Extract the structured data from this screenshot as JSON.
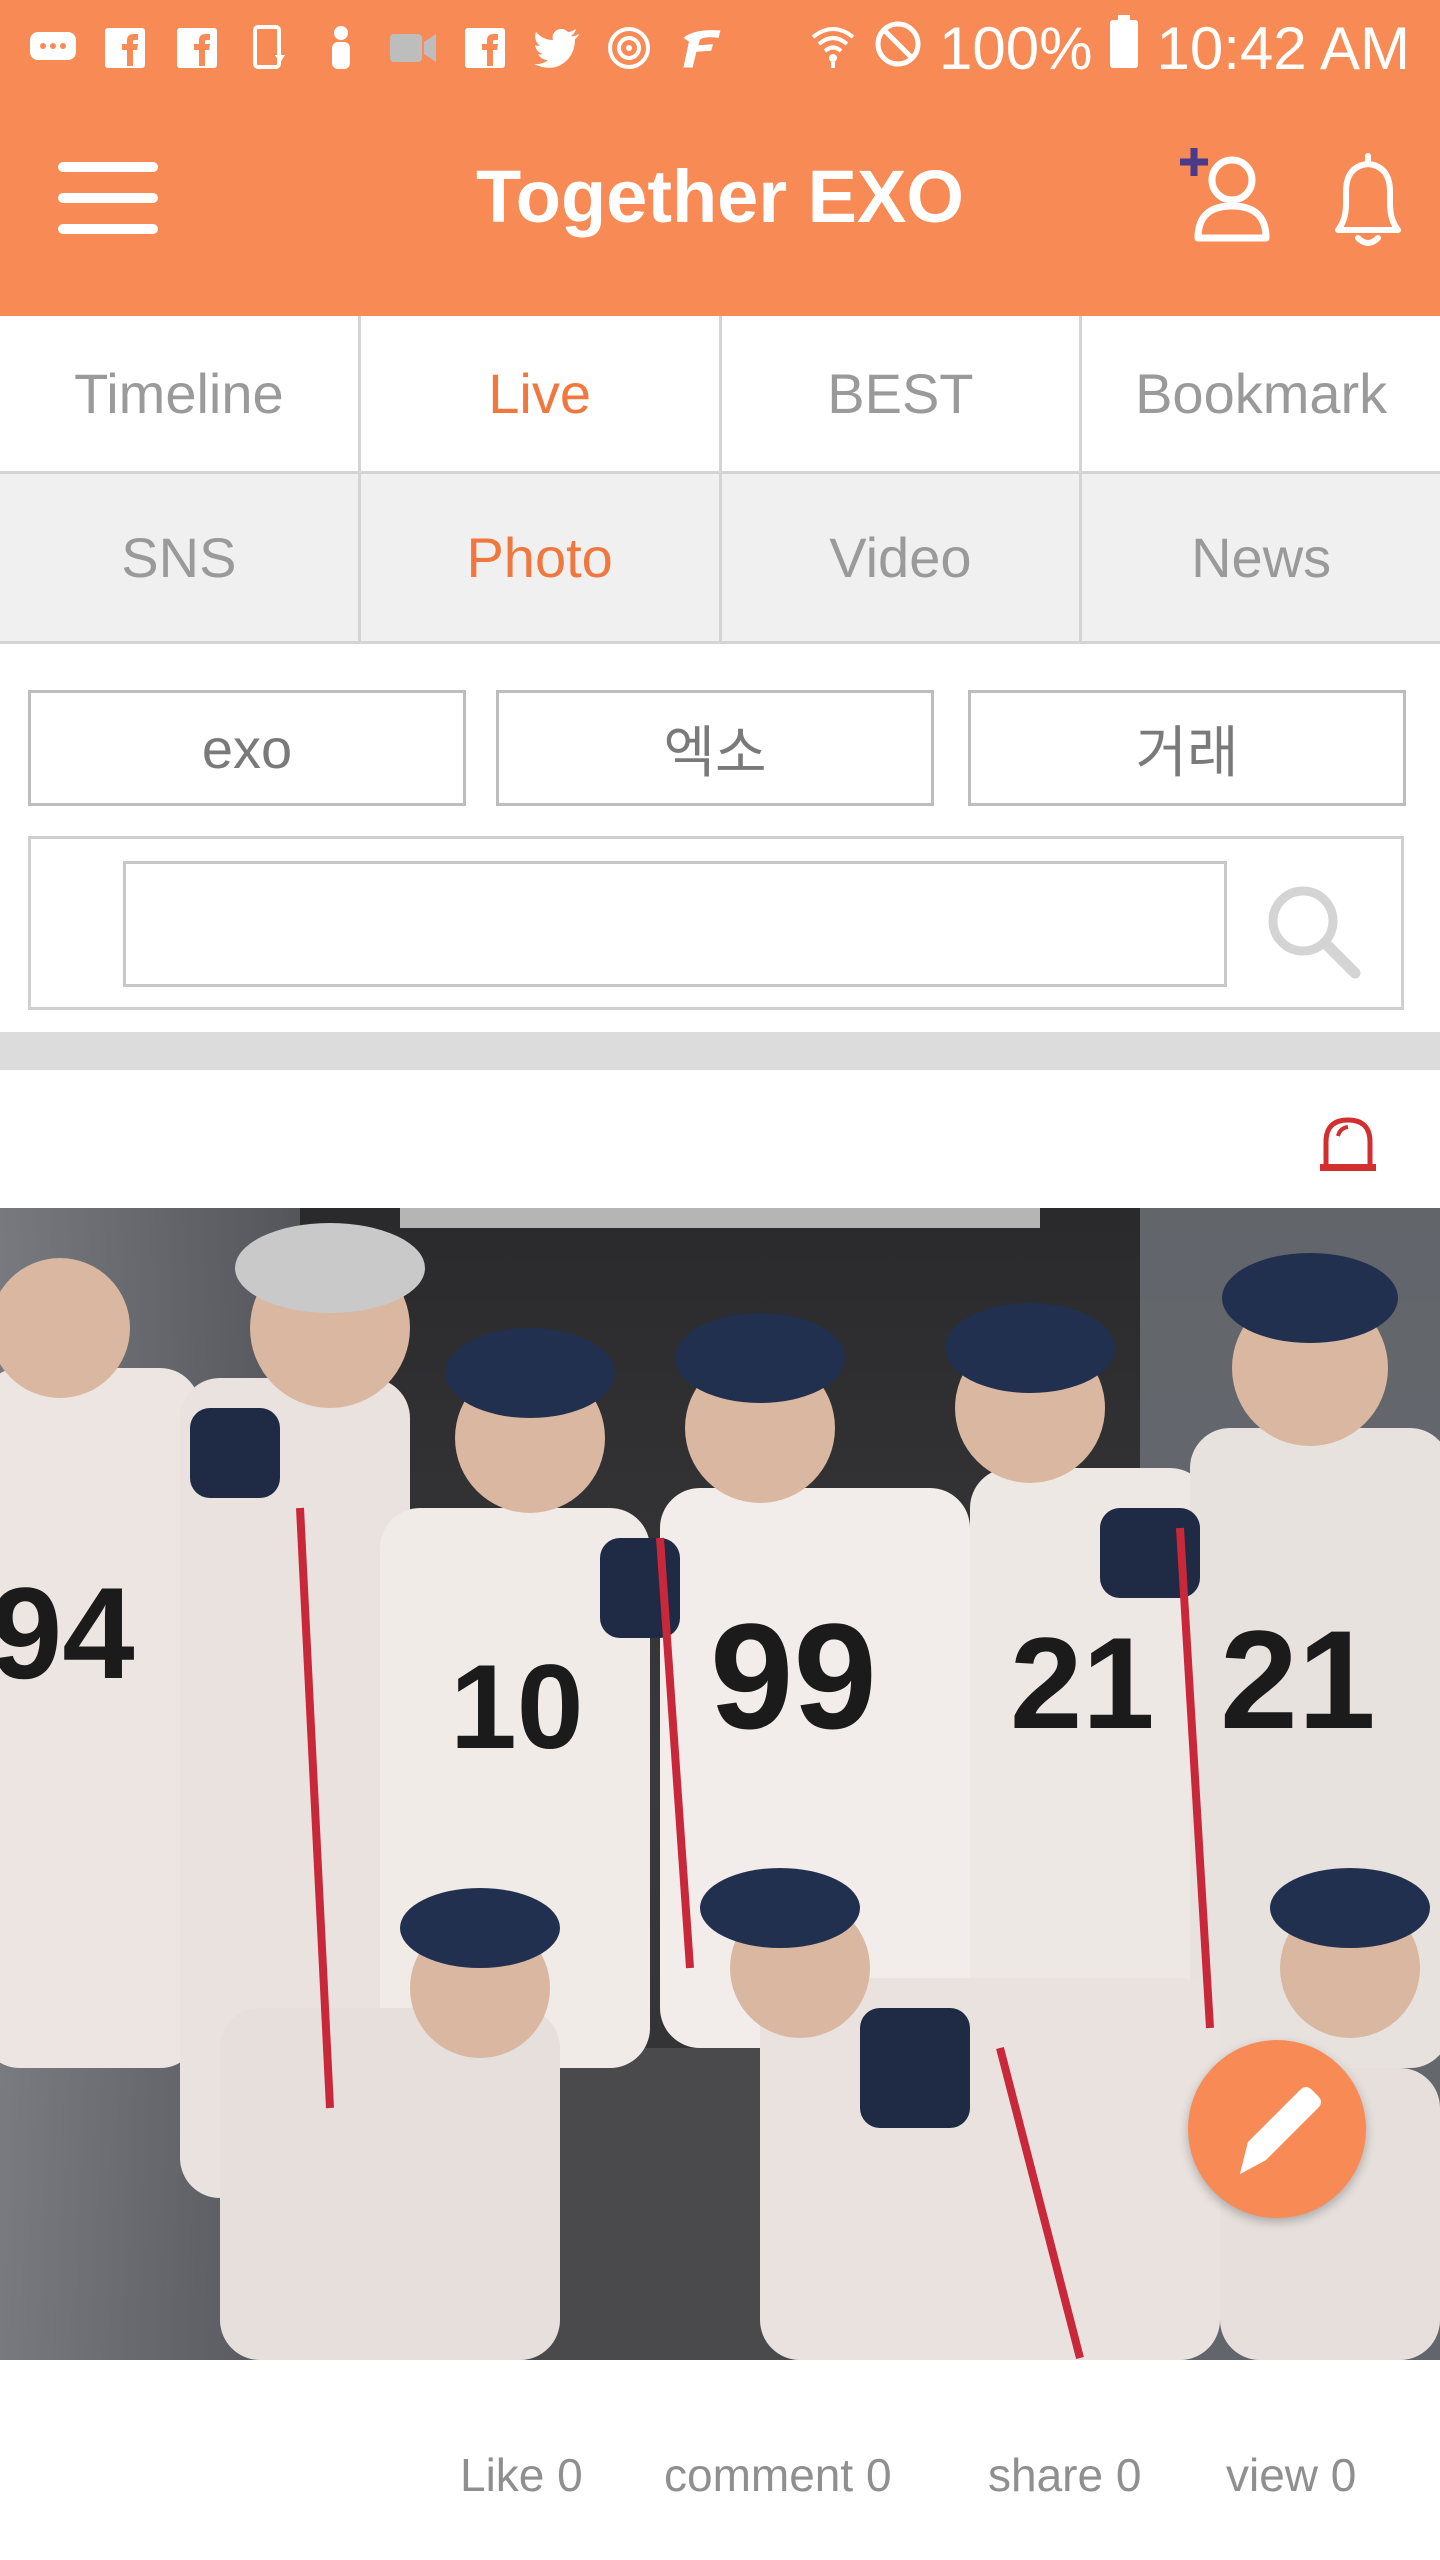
{
  "status_bar": {
    "battery": "100%",
    "time": "10:42 AM",
    "icons": [
      "message-icon",
      "facebook-icon",
      "facebook-icon",
      "phone-download-icon",
      "person-icon",
      "video-icon",
      "facebook-icon",
      "twitter-icon",
      "sync-icon",
      "f-app-icon",
      "wifi-icon",
      "do-not-disturb-icon",
      "battery-icon"
    ]
  },
  "app_bar": {
    "title": "Together EXO",
    "icons": [
      "menu-icon",
      "add-user-icon",
      "bell-icon"
    ]
  },
  "tabs_primary": [
    {
      "label": "Timeline",
      "active": false
    },
    {
      "label": "Live",
      "active": true
    },
    {
      "label": "BEST",
      "active": false
    },
    {
      "label": "Bookmark",
      "active": false
    }
  ],
  "tabs_secondary": [
    {
      "label": "SNS",
      "active": false
    },
    {
      "label": "Photo",
      "active": true
    },
    {
      "label": "Video",
      "active": false
    },
    {
      "label": "News",
      "active": false
    }
  ],
  "keyword_chips": [
    "exo",
    "엑소",
    "거래"
  ],
  "search": {
    "value": "",
    "placeholder": ""
  },
  "post": {
    "alarm_icon": "alarm-siren-icon",
    "image_alt": "group photo",
    "stats": {
      "like": "Like 0",
      "comment": "comment 0",
      "share": "share 0",
      "view": "view 0"
    }
  },
  "fab": {
    "icon": "pencil-icon"
  },
  "colors": {
    "accent": "#F78A55",
    "active_tab": "#F0783E",
    "alarm": "#D32F2F"
  }
}
